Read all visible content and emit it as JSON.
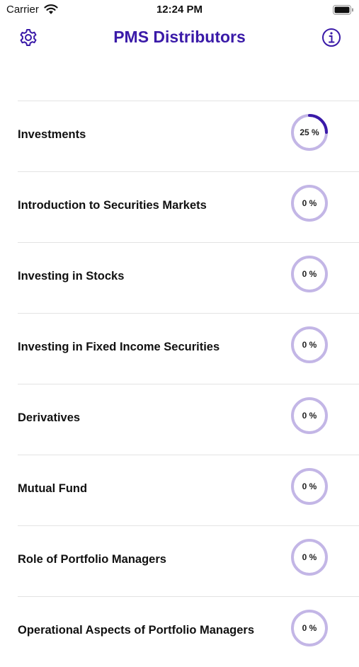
{
  "status": {
    "carrier": "Carrier",
    "time": "12:24 PM"
  },
  "nav": {
    "title": "PMS Distributors",
    "left_icon": "gear-icon",
    "right_icon": "info-icon"
  },
  "colors": {
    "accent": "#3a1aa8",
    "ring_track": "#c3b6e6",
    "ring_progress": "#3a1aa8"
  },
  "topics": [
    {
      "label": "Investments",
      "progress_text": "25 %",
      "progress": 25
    },
    {
      "label": "Introduction to Securities Markets",
      "progress_text": "0 %",
      "progress": 0
    },
    {
      "label": "Investing in Stocks",
      "progress_text": "0 %",
      "progress": 0
    },
    {
      "label": "Investing in Fixed Income Securities",
      "progress_text": "0 %",
      "progress": 0
    },
    {
      "label": "Derivatives",
      "progress_text": "0 %",
      "progress": 0
    },
    {
      "label": "Mutual Fund",
      "progress_text": "0 %",
      "progress": 0
    },
    {
      "label": "Role of Portfolio Managers",
      "progress_text": "0 %",
      "progress": 0
    },
    {
      "label": "Operational Aspects of Portfolio Managers",
      "progress_text": "0 %",
      "progress": 0
    }
  ]
}
